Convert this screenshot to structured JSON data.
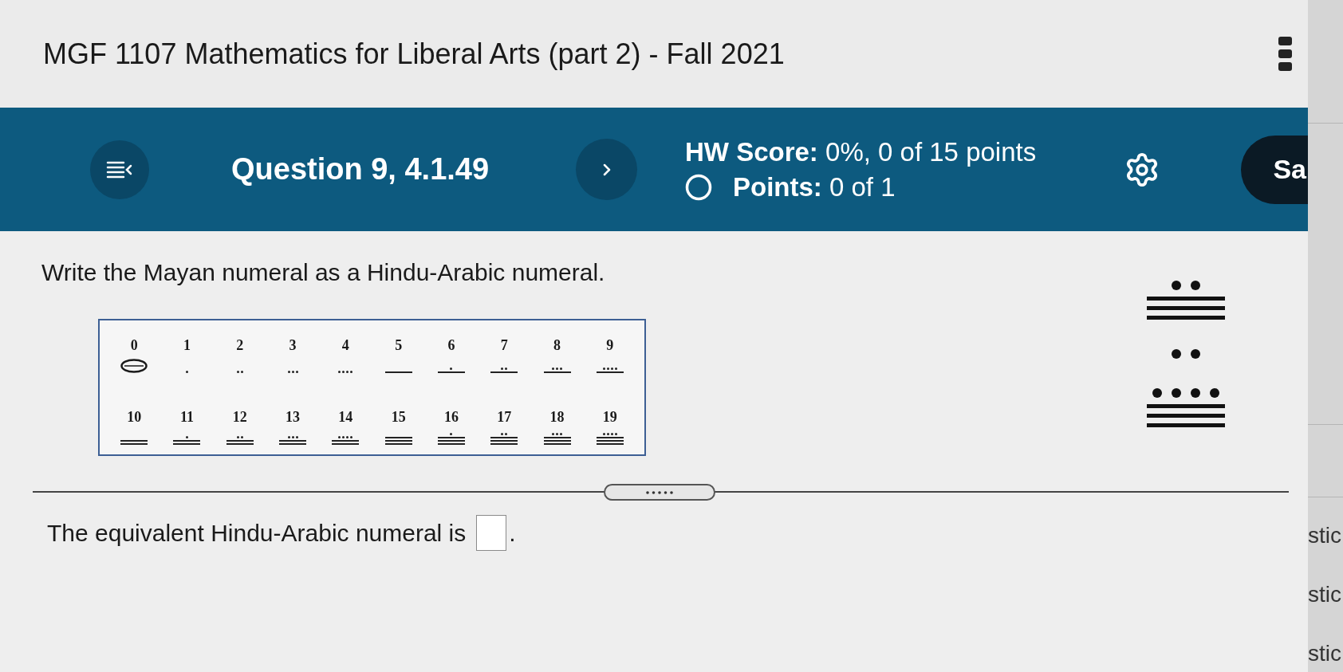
{
  "header": {
    "title": "MGF 1107 Mathematics for Liberal Arts (part 2) - Fall 2021"
  },
  "question_bar": {
    "question": "Question 9, 4.1.49",
    "score": "**HW Score:** 0%, 0 of 15 points",
    "points": "**Points:** 0 of 1",
    "save_button": "Sa"
  },
  "question": {
    "prompt": "Write the Mayan numeral as a Hindu-Arabic numeral.",
    "reference_table": [
      {
        "cells": [
          {
            "label": "0",
            "marks": [
              {
                "kind": "shell"
              }
            ]
          },
          {
            "label": "1",
            "marks": [
              {
                "kind": "dot"
              }
            ]
          },
          {
            "label": "2",
            "marks": [
              {
                "kind": "dot"
              },
              {
                "kind": "dot"
              }
            ]
          },
          {
            "label": "3",
            "marks": [
              {
                "kind": "dot"
              },
              {
                "kind": "dot"
              },
              {
                "kind": "dot"
              }
            ]
          },
          {
            "label": "4",
            "marks": [
              {
                "kind": "dot"
              },
              {
                "kind": "dot"
              },
              {
                "kind": "dot"
              },
              {
                "kind": "dot"
              }
            ]
          },
          {
            "label": "5",
            "marks": [
              {
                "kind": "bar"
              }
            ]
          },
          {
            "label": "6",
            "marks": [
              {
                "kind": "dot"
              },
              {
                "kind": "bar"
              }
            ]
          },
          {
            "label": "7",
            "marks": [
              {
                "kind": "dot"
              },
              {
                "kind": "dot"
              },
              {
                "kind": "bar"
              }
            ]
          },
          {
            "label": "8",
            "marks": [
              {
                "kind": "dot"
              },
              {
                "kind": "dot"
              },
              {
                "kind": "dot"
              },
              {
                "kind": "bar"
              }
            ]
          },
          {
            "label": "9",
            "marks": [
              {
                "kind": "dot"
              },
              {
                "kind": "dot"
              },
              {
                "kind": "dot"
              },
              {
                "kind": "dot"
              },
              {
                "kind": "bar"
              }
            ]
          }
        ]
      },
      {
        "cells": [
          {
            "label": "10",
            "marks": [
              {
                "kind": "bar"
              },
              {
                "kind": "bar"
              }
            ]
          },
          {
            "label": "11",
            "marks": [
              {
                "kind": "dot"
              },
              {
                "kind": "bar"
              },
              {
                "kind": "bar"
              }
            ]
          },
          {
            "label": "12",
            "marks": [
              {
                "kind": "dot"
              },
              {
                "kind": "dot"
              },
              {
                "kind": "bar"
              },
              {
                "kind": "bar"
              }
            ]
          },
          {
            "label": "13",
            "marks": [
              {
                "kind": "dot"
              },
              {
                "kind": "dot"
              },
              {
                "kind": "dot"
              },
              {
                "kind": "bar"
              },
              {
                "kind": "bar"
              }
            ]
          },
          {
            "label": "14",
            "marks": [
              {
                "kind": "dot"
              },
              {
                "kind": "dot"
              },
              {
                "kind": "dot"
              },
              {
                "kind": "dot"
              },
              {
                "kind": "bar"
              },
              {
                "kind": "bar"
              }
            ]
          },
          {
            "label": "15",
            "marks": [
              {
                "kind": "bar"
              },
              {
                "kind": "bar"
              },
              {
                "kind": "bar"
              }
            ]
          },
          {
            "label": "16",
            "marks": [
              {
                "kind": "dot"
              },
              {
                "kind": "bar"
              },
              {
                "kind": "bar"
              },
              {
                "kind": "bar"
              }
            ]
          },
          {
            "label": "17",
            "marks": [
              {
                "kind": "dot"
              },
              {
                "kind": "dot"
              },
              {
                "kind": "bar"
              },
              {
                "kind": "bar"
              },
              {
                "kind": "bar"
              }
            ]
          },
          {
            "label": "18",
            "marks": [
              {
                "kind": "dot"
              },
              {
                "kind": "dot"
              },
              {
                "kind": "dot"
              },
              {
                "kind": "bar"
              },
              {
                "kind": "bar"
              },
              {
                "kind": "bar"
              }
            ]
          },
          {
            "label": "19",
            "marks": [
              {
                "kind": "dot"
              },
              {
                "kind": "dot"
              },
              {
                "kind": "dot"
              },
              {
                "kind": "dot"
              },
              {
                "kind": "bar"
              },
              {
                "kind": "bar"
              },
              {
                "kind": "bar"
              }
            ]
          }
        ]
      }
    ],
    "mayan_numeral": [
      {
        "marks": [
          {
            "kind": "dot"
          },
          {
            "kind": "dot"
          },
          {
            "kind": "bar"
          },
          {
            "kind": "bar"
          },
          {
            "kind": "bar"
          }
        ]
      },
      {
        "marks": [
          {
            "kind": "dot"
          },
          {
            "kind": "dot"
          }
        ]
      },
      {
        "marks": [
          {
            "kind": "dot"
          },
          {
            "kind": "dot"
          },
          {
            "kind": "dot"
          },
          {
            "kind": "dot"
          },
          {
            "kind": "bar"
          },
          {
            "kind": "bar"
          },
          {
            "kind": "bar"
          }
        ]
      }
    ]
  },
  "answer": {
    "text_before": "The equivalent Hindu-Arabic numeral is",
    "text_after": "."
  },
  "side_panel": {
    "items": [
      "stic",
      "stic",
      "stic"
    ]
  }
}
